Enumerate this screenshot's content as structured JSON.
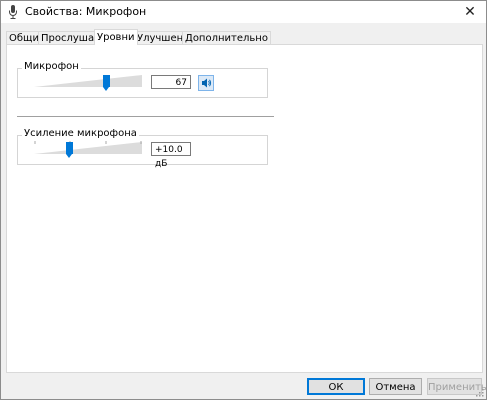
{
  "window": {
    "title": "Свойства: Микрофон",
    "close_glyph": "✕"
  },
  "tabs": [
    {
      "label": "Общие",
      "active": false
    },
    {
      "label": "Прослушать",
      "active": false
    },
    {
      "label": "Уровни",
      "active": true
    },
    {
      "label": "Улучшения",
      "active": false
    },
    {
      "label": "Дополнительно",
      "active": false
    }
  ],
  "microphone": {
    "label": "Микрофон",
    "value": "67",
    "level_fraction": 0.67
  },
  "boost": {
    "label": "Усиление микрофона",
    "value": "+10.0 дБ",
    "level_fraction": 0.33
  },
  "buttons": {
    "ok": "ОК",
    "cancel": "Отмена",
    "apply": "Применить"
  },
  "colors": {
    "accent": "#0078d7",
    "background": "#f0f0f0",
    "panel": "#ffffff"
  }
}
